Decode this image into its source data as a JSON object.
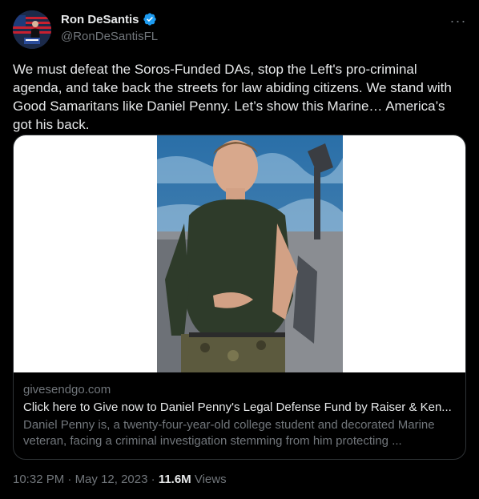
{
  "author": {
    "display_name": "Ron DeSantis",
    "handle": "@RonDeSantisFL",
    "verified_icon": "verified-badge-icon"
  },
  "tweet": {
    "text": "We must defeat the Soros-Funded DAs, stop the Left's pro-criminal agenda, and take back the streets for law abiding citizens. We stand with Good Samaritans like Daniel Penny. Let’s show this Marine… America’s got his back."
  },
  "menu": {
    "more_label": "···"
  },
  "link_card": {
    "domain": "givesendgo.com",
    "title": "Click here to Give now to Daniel Penny's Legal Defense Fund by Raiser & Ken...",
    "description": "Daniel Penny is, a twenty-four-year-old college student and decorated Marine veteran, facing a criminal investigation stemming from him protecting ..."
  },
  "meta": {
    "time": "10:32 PM",
    "separator": "·",
    "date": "May 12, 2023",
    "views_count": "11.6M",
    "views_label": "Views"
  },
  "colors": {
    "background": "#000000",
    "text": "#e7e9ea",
    "muted": "#71767b",
    "border": "#2f3336",
    "verified": "#1d9bf0"
  }
}
